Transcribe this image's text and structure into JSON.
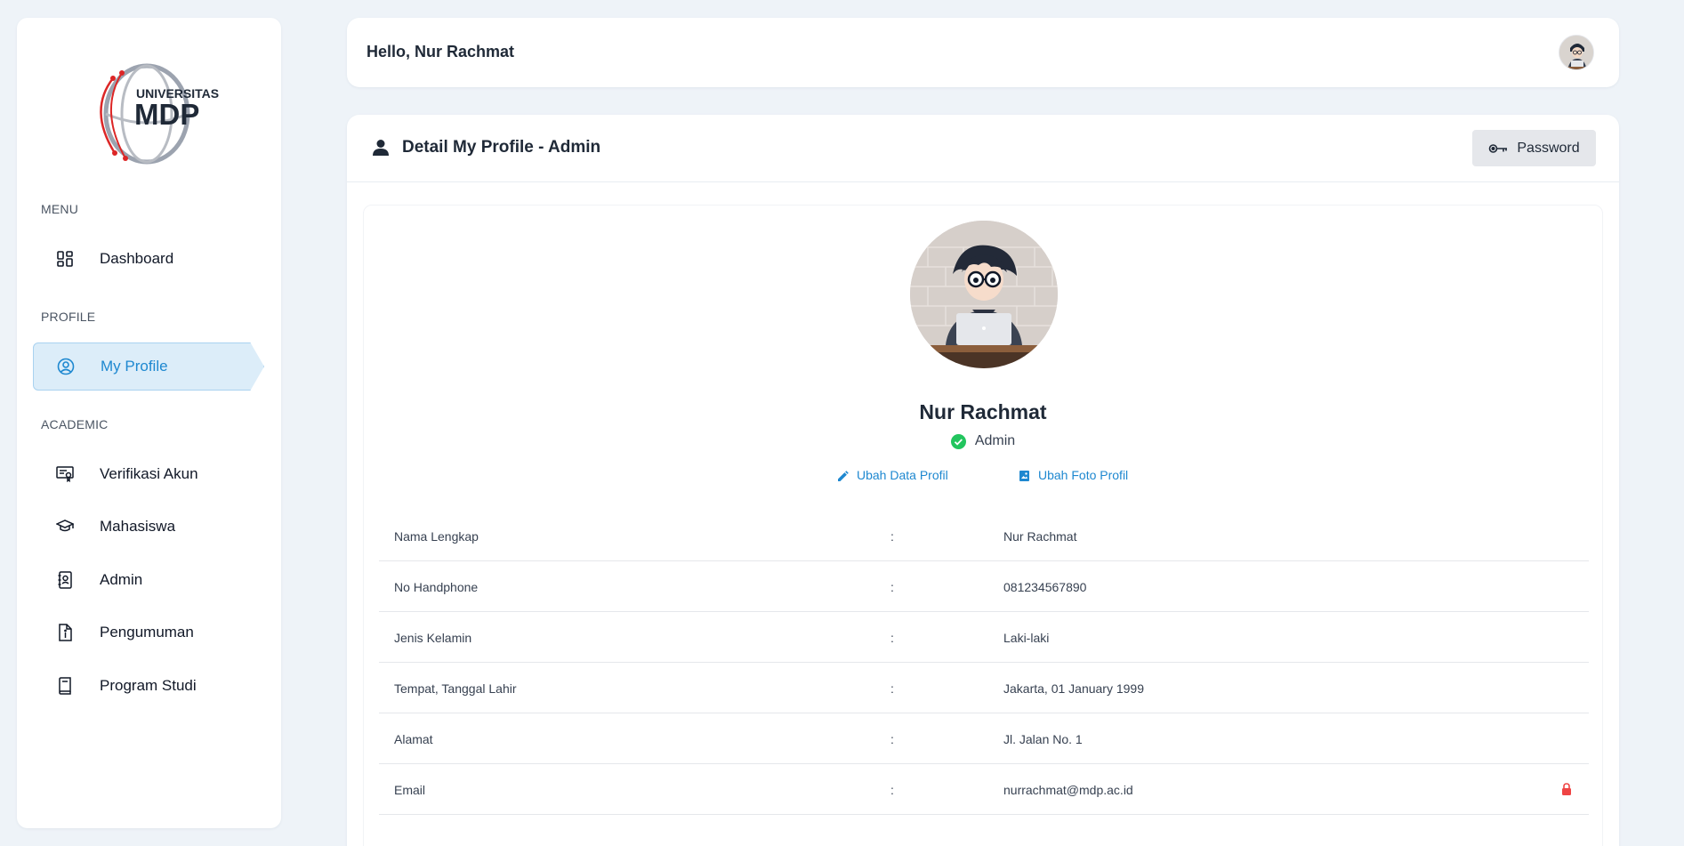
{
  "logo": {
    "line1": "UNIVERSITAS",
    "line2": "MDP"
  },
  "sidebar": {
    "sections": [
      {
        "title": "MENU"
      },
      {
        "title": "PROFILE"
      },
      {
        "title": "ACADEMIC"
      }
    ],
    "items": [
      {
        "label": "Dashboard",
        "icon": "dashboard-icon"
      },
      {
        "label": "My Profile",
        "icon": "user-circle-icon",
        "active": true
      },
      {
        "label": "Verifikasi Akun",
        "icon": "certificate-icon"
      },
      {
        "label": "Mahasiswa",
        "icon": "graduation-cap-icon"
      },
      {
        "label": "Admin",
        "icon": "address-book-icon"
      },
      {
        "label": "Pengumuman",
        "icon": "document-info-icon"
      },
      {
        "label": "Program Studi",
        "icon": "book-icon"
      }
    ]
  },
  "header": {
    "greeting": "Hello, Nur Rachmat"
  },
  "card": {
    "title": "Detail My Profile - Admin",
    "password_button": "Password"
  },
  "profile": {
    "name": "Nur Rachmat",
    "role": "Admin",
    "edit_data_link": "Ubah Data Profil",
    "edit_photo_link": "Ubah Foto Profil"
  },
  "details": [
    {
      "label": "Nama Lengkap",
      "sep": ":",
      "value": "Nur Rachmat"
    },
    {
      "label": "No Handphone",
      "sep": ":",
      "value": "081234567890"
    },
    {
      "label": "Jenis Kelamin",
      "sep": ":",
      "value": "Laki-laki"
    },
    {
      "label": "Tempat, Tanggal Lahir",
      "sep": ":",
      "value": "Jakarta, 01 January 1999"
    },
    {
      "label": "Alamat",
      "sep": ":",
      "value": "Jl. Jalan No. 1"
    },
    {
      "label": "Email",
      "sep": ":",
      "value": "nurrachmat@mdp.ac.id",
      "locked": true
    }
  ],
  "colors": {
    "accent": "#1e88d0",
    "active_bg": "#dcedf9",
    "success": "#22c55e",
    "lock": "#ef4444",
    "page_bg": "#eef3f8"
  }
}
